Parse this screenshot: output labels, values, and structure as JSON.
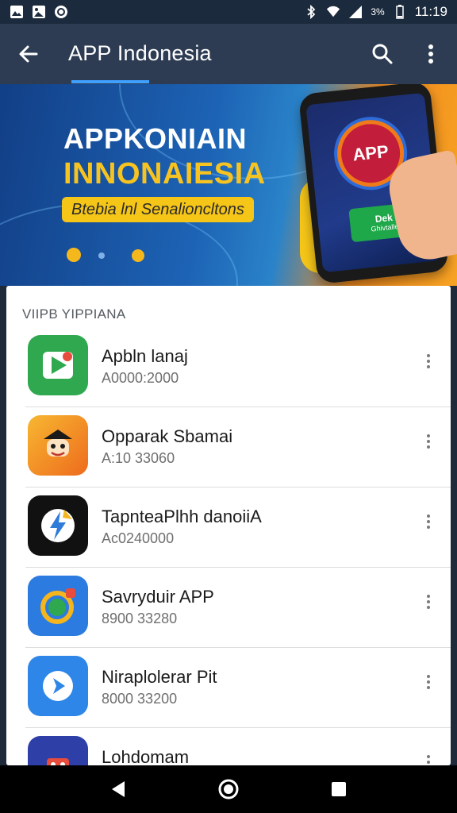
{
  "status_bar": {
    "time": "11:19",
    "battery_text": "3%",
    "icons": [
      "image-icon",
      "photo-icon",
      "sync-icon",
      "bluetooth-icon",
      "wifi-icon",
      "signal-icon",
      "battery-icon"
    ]
  },
  "app_bar": {
    "title": "APP Indonesia",
    "back_icon": "arrow-left-icon",
    "search_icon": "search-icon",
    "more_icon": "more-vert-icon"
  },
  "banner": {
    "headline_line1": "APPKONIAIN",
    "headline_line2": "INNONAIESIA",
    "tagline": "Btebia lnl Senalioncltons",
    "phone_badge": "APP",
    "phone_button_line1": "Dek",
    "phone_button_line2": "Ghivtalle"
  },
  "section": {
    "title": "VIIPB YIPPIANA"
  },
  "apps": [
    {
      "name": "Apbln lanaj",
      "meta": "A0000:2000",
      "icon": "play-store-icon",
      "color": "#2fa84f"
    },
    {
      "name": "Opparak Sbamai",
      "meta": "A:10 33060",
      "icon": "pirate-mascot-icon",
      "color": "#f08a24"
    },
    {
      "name": "TapnteaPlhh danoiiA",
      "meta": "Ac0240000",
      "icon": "messenger-bolt-icon",
      "color": "#111111"
    },
    {
      "name": "Savryduir APP",
      "meta": "8900 33280",
      "icon": "chat-bubble-icon",
      "color": "#2c7be0"
    },
    {
      "name": "Niraplolerar Pit",
      "meta": "8000 33200",
      "icon": "send-arrow-icon",
      "color": "#2e86e8"
    },
    {
      "name": "Lohdomam",
      "meta": "",
      "icon": "red-gift-icon",
      "color": "#2f3fa8"
    }
  ],
  "nav_bar": {
    "back_icon": "nav-back-triangle-icon",
    "home_icon": "nav-home-circle-icon",
    "recents_icon": "nav-recents-square-icon"
  },
  "colors": {
    "status_bar": "#1b2a3c",
    "app_bar": "#2d3c52",
    "accent": "#3fa0ff",
    "banner_yellow": "#f5c518"
  }
}
